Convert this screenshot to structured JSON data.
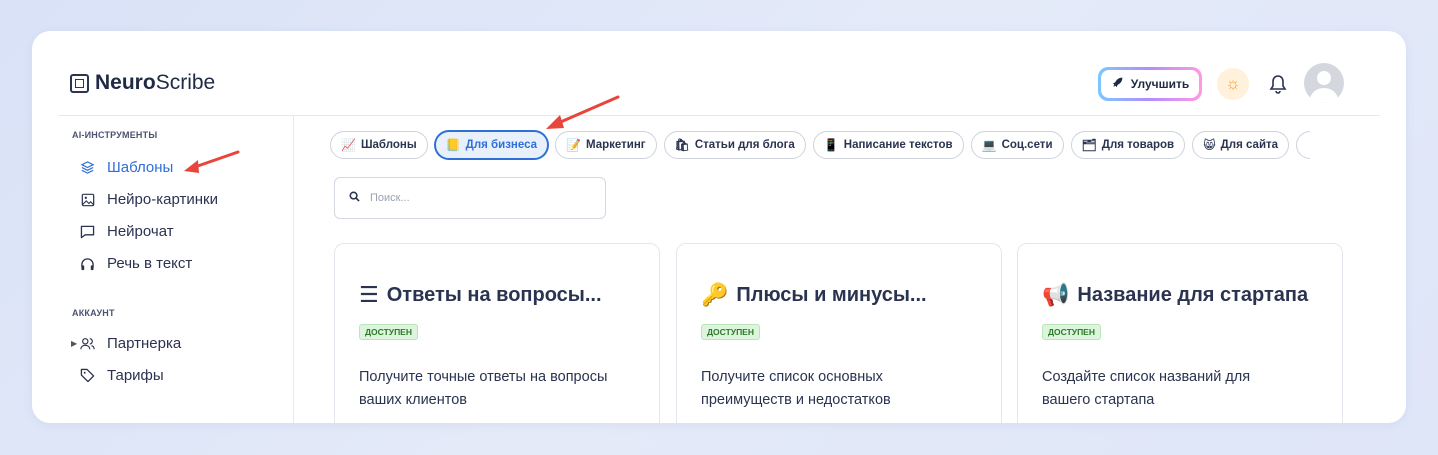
{
  "app": {
    "logo_bold": "Neuro",
    "logo_light": "Scribe"
  },
  "header": {
    "upgrade_label": "Улучшить",
    "theme_icon": "sun-icon",
    "bell_icon": "bell-icon"
  },
  "sidebar": {
    "section_ai": "AI-ИНСТРУМЕНТЫ",
    "items_ai": [
      {
        "label": "Шаблоны",
        "icon": "layers-icon",
        "active": true
      },
      {
        "label": "Нейро-картинки",
        "icon": "image-icon"
      },
      {
        "label": "Нейрочат",
        "icon": "chat-icon"
      },
      {
        "label": "Речь в текст",
        "icon": "headphones-icon"
      }
    ],
    "section_account": "АККАУНТ",
    "items_account": [
      {
        "label": "Партнерка",
        "icon": "users-icon"
      },
      {
        "label": "Тарифы",
        "icon": "tag-icon"
      }
    ]
  },
  "tabs": [
    {
      "emoji": "📈",
      "label": "Шаблоны"
    },
    {
      "emoji": "📒",
      "label": "Для бизнеса",
      "active": true
    },
    {
      "emoji": "📝",
      "label": "Маркетинг"
    },
    {
      "emoji": "🛍",
      "label": "Статьи для блога"
    },
    {
      "emoji": "📱",
      "label": "Написание текстов"
    },
    {
      "emoji": "💻",
      "label": "Соц.сети"
    },
    {
      "emoji": "🗂",
      "label": "Для товаров"
    },
    {
      "emoji": "😸",
      "label": "Для сайта"
    }
  ],
  "search": {
    "placeholder": "Поиск..."
  },
  "cards": [
    {
      "icon": "☰",
      "title": "Ответы на вопросы...",
      "badge": "ДОСТУПЕН",
      "desc": "Получите точные ответы на вопросы ваших клиентов"
    },
    {
      "icon": "🔑",
      "title": "Плюсы и минусы...",
      "badge": "ДОСТУПЕН",
      "desc": "Получите список основных преимуществ и недостатков"
    },
    {
      "icon": "📢",
      "title": "Название для стартапа",
      "badge": "ДОСТУПЕН",
      "desc": "Создайте список названий для вашего стартапа"
    }
  ],
  "colors": {
    "accent": "#2f6fd6",
    "annotation": "#e8453c",
    "badge_bg": "#dcf5dc"
  }
}
